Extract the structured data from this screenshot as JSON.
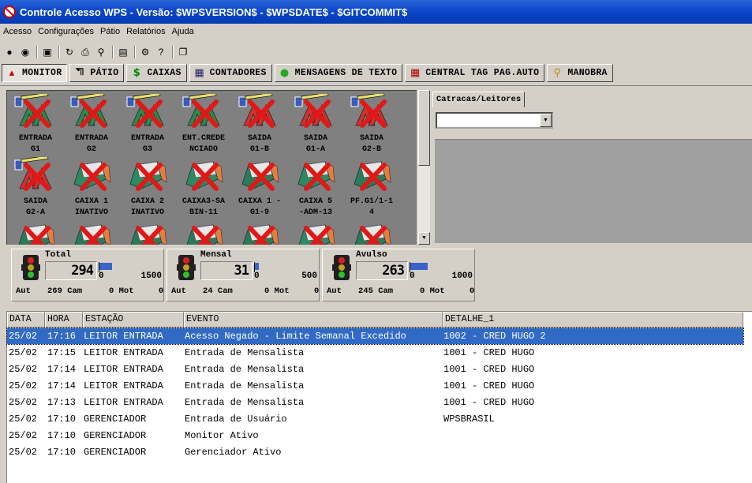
{
  "window": {
    "title": "Controle Acesso WPS - Versão: $WPSVERSION$ - $WPSDATE$ - $GITCOMMIT$"
  },
  "menu": [
    "Acesso",
    "Configurações",
    "Pátio",
    "Relatórios",
    "Ajuda"
  ],
  "tabs": [
    {
      "label": "MONITOR",
      "icon": "sitemap-icon"
    },
    {
      "label": "PÁTIO",
      "icon": "car-icon"
    },
    {
      "label": "CAIXAS",
      "icon": "dollar-icon"
    },
    {
      "label": "CONTADORES",
      "icon": "counter-icon"
    },
    {
      "label": "MENSAGENS DE TEXTO",
      "icon": "message-icon"
    },
    {
      "label": "CENTRAL TAG PAG.AUTO",
      "icon": "tag-icon"
    },
    {
      "label": "MANOBRA",
      "icon": "key-icon"
    }
  ],
  "devices": [
    {
      "label": "ENTRADA G1",
      "l1": "ENTRADA",
      "l2": "G1",
      "type": "gate-entry"
    },
    {
      "label": "ENTRADA G2",
      "l1": "ENTRADA",
      "l2": "G2",
      "type": "gate-entry"
    },
    {
      "label": "ENTRADA G3",
      "l1": "ENTRADA",
      "l2": "G3",
      "type": "gate-entry"
    },
    {
      "label": "ENT.CREDENCIADO",
      "l1": "ENT.CREDE",
      "l2": "NCIADO",
      "type": "gate-entry"
    },
    {
      "label": "SAIDA G1-B",
      "l1": "SAIDA",
      "l2": "G1-B",
      "type": "gate-exit"
    },
    {
      "label": "SAIDA G1-A",
      "l1": "SAIDA",
      "l2": "G1-A",
      "type": "gate-exit"
    },
    {
      "label": "SAIDA G2-B",
      "l1": "SAIDA",
      "l2": "G2-B",
      "type": "gate-exit"
    },
    {
      "label": "SAIDA G2-A",
      "l1": "SAIDA",
      "l2": "G2-A",
      "type": "gate-exit"
    },
    {
      "label": "CAIXA 1 INATIVO",
      "l1": "CAIXA 1",
      "l2": "INATIVO",
      "type": "cashier"
    },
    {
      "label": "CAIXA 2 INATIVO",
      "l1": "CAIXA 2",
      "l2": "INATIVO",
      "type": "cashier"
    },
    {
      "label": "CAIXA3-SABIN-11",
      "l1": "CAIXA3-SA",
      "l2": "BIN-11",
      "type": "cashier"
    },
    {
      "label": "CAIXA 1 - G1-9",
      "l1": "CAIXA 1 -",
      "l2": "G1-9",
      "type": "cashier-off"
    },
    {
      "label": "CAIXA 5 -ADM-13",
      "l1": "CAIXA 5",
      "l2": "-ADM-13",
      "type": "cashier"
    },
    {
      "label": "PF.G1/1-14",
      "l1": "PF.G1/1-1",
      "l2": "4",
      "type": "cashier-off"
    },
    {
      "label": "",
      "l1": "",
      "l2": "",
      "type": "cashier-off"
    },
    {
      "label": "",
      "l1": "",
      "l2": "",
      "type": "cashier-off"
    },
    {
      "label": "",
      "l1": "",
      "l2": "",
      "type": "cashier-off"
    },
    {
      "label": "",
      "l1": "",
      "l2": "",
      "type": "cashier-off"
    },
    {
      "label": "",
      "l1": "",
      "l2": "",
      "type": "cashier-off"
    },
    {
      "label": "",
      "l1": "",
      "l2": "",
      "type": "cashier"
    },
    {
      "label": "",
      "l1": "",
      "l2": "",
      "type": "cashier-off"
    }
  ],
  "right_panel": {
    "tab_label": "Catracas/Leitores",
    "combo_value": ""
  },
  "counters": [
    {
      "title": "Total",
      "value": "294",
      "min": "0",
      "max": "1500",
      "level": 0.196,
      "aut_label": "Aut",
      "cam": "269 Cam",
      "mot": "0 Mot",
      "extra": "0"
    },
    {
      "title": "Mensal",
      "value": "31",
      "min": "0",
      "max": "500",
      "level": 0.062,
      "aut_label": "Aut",
      "cam": "24 Cam",
      "mot": "0 Mot",
      "extra": "0"
    },
    {
      "title": "Avulso",
      "value": "263",
      "min": "0",
      "max": "1000",
      "level": 0.263,
      "aut_label": "Aut",
      "cam": "245 Cam",
      "mot": "0 Mot",
      "extra": "0"
    }
  ],
  "log": {
    "columns": [
      "DATA",
      "HORA",
      "ESTAÇÃO",
      "EVENTO",
      "DETALHE_1"
    ],
    "rows": [
      {
        "data": "25/02",
        "hora": "17:16",
        "estacao": "LEITOR ENTRADA",
        "evento": "Acesso Negado - Limite Semanal Excedido",
        "detalhe": "1002 - CRED HUGO 2",
        "selected": true
      },
      {
        "data": "25/02",
        "hora": "17:15",
        "estacao": "LEITOR ENTRADA",
        "evento": "Entrada de Mensalista",
        "detalhe": "1001 - CRED HUGO",
        "selected": false
      },
      {
        "data": "25/02",
        "hora": "17:14",
        "estacao": "LEITOR ENTRADA",
        "evento": "Entrada de Mensalista",
        "detalhe": "1001 - CRED HUGO",
        "selected": false
      },
      {
        "data": "25/02",
        "hora": "17:14",
        "estacao": "LEITOR ENTRADA",
        "evento": "Entrada de Mensalista",
        "detalhe": "1001 - CRED HUGO",
        "selected": false
      },
      {
        "data": "25/02",
        "hora": "17:13",
        "estacao": "LEITOR ENTRADA",
        "evento": "Entrada de Mensalista",
        "detalhe": "1001 - CRED HUGO",
        "selected": false
      },
      {
        "data": "25/02",
        "hora": "17:10",
        "estacao": "GERENCIADOR",
        "evento": "Entrada de Usuário",
        "detalhe": "WPSBRASIL",
        "selected": false
      },
      {
        "data": "25/02",
        "hora": "17:10",
        "estacao": "GERENCIADOR",
        "evento": "Monitor Ativo",
        "detalhe": "",
        "selected": false
      },
      {
        "data": "25/02",
        "hora": "17:10",
        "estacao": "GERENCIADOR",
        "evento": "Gerenciador Ativo",
        "detalhe": "",
        "selected": false
      }
    ]
  },
  "colors": {
    "title_bar": "#0a46c8",
    "selection": "#316ac5",
    "gauge": "#3a64c8",
    "x_mark": "#e01818"
  }
}
